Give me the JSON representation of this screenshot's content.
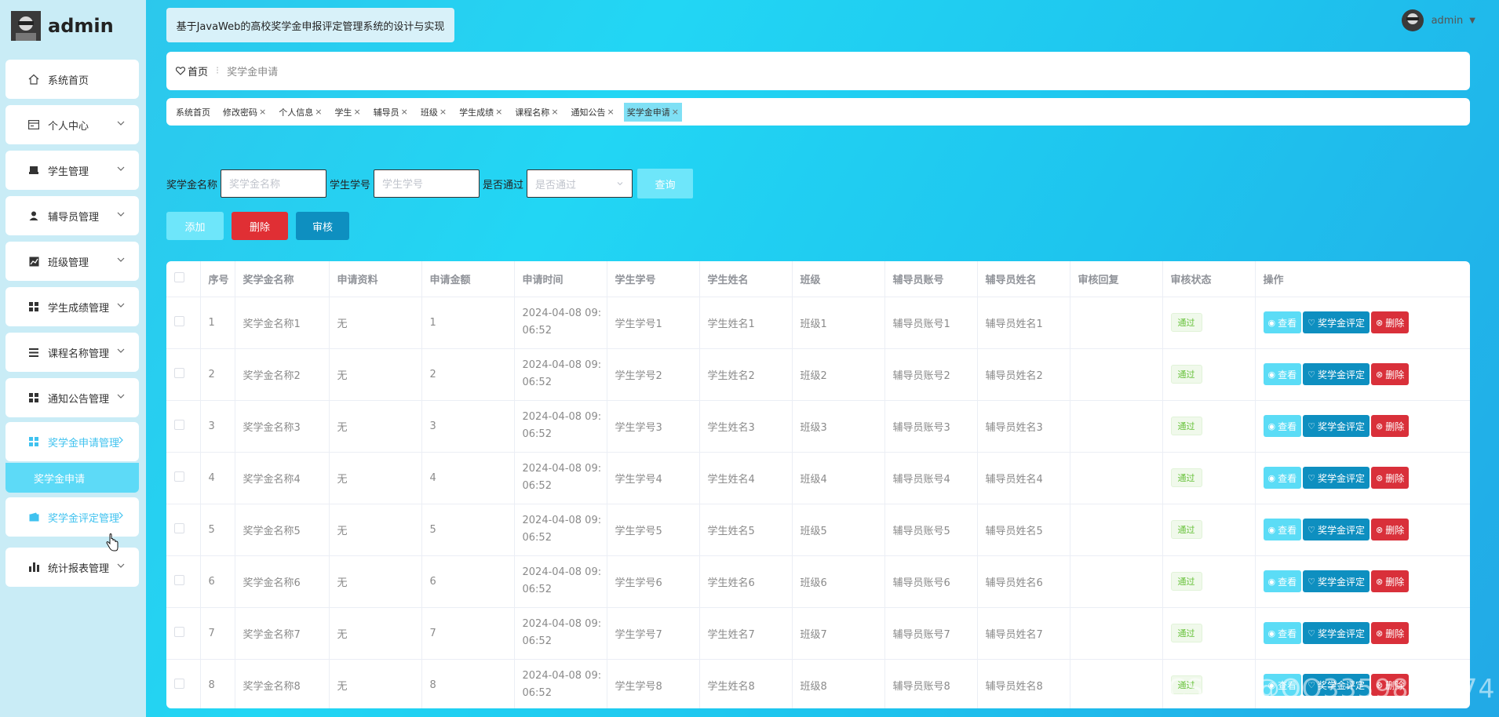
{
  "sidebar": {
    "brand": "admin",
    "items": [
      {
        "label": "系统首页",
        "icon": "home-icon"
      },
      {
        "label": "个人中心",
        "icon": "id-card-icon"
      },
      {
        "label": "学生管理",
        "icon": "student-icon"
      },
      {
        "label": "辅导员管理",
        "icon": "user-icon"
      },
      {
        "label": "班级管理",
        "icon": "chart-icon"
      },
      {
        "label": "学生成绩管理",
        "icon": "grid-icon"
      },
      {
        "label": "课程名称管理",
        "icon": "list-icon"
      },
      {
        "label": "通知公告管理",
        "icon": "grid-icon"
      },
      {
        "label": "奖学金申请管理",
        "icon": "grid-icon"
      },
      {
        "label": "奖学金评定管理",
        "icon": "wallet-icon"
      },
      {
        "label": "统计报表管理",
        "icon": "bar-chart-icon"
      }
    ],
    "sub_item": "奖学金申请"
  },
  "header": {
    "title": "基于JavaWeb的高校奖学金申报评定管理系统的设计与实现",
    "user": "admin"
  },
  "breadcrumb": {
    "home": "首页",
    "current": "奖学金申请"
  },
  "tags": [
    "系统首页",
    "修改密码",
    "个人信息",
    "学生",
    "辅导员",
    "班级",
    "学生成绩",
    "课程名称",
    "通知公告",
    "奖学金申请"
  ],
  "search": {
    "name_label": "奖学金名称",
    "name_placeholder": "奖学金名称",
    "no_label": "学生学号",
    "no_placeholder": "学生学号",
    "pass_label": "是否通过",
    "pass_placeholder": "是否通过",
    "query": "查询"
  },
  "actions": {
    "add": "添加",
    "delete": "删除",
    "audit": "审核"
  },
  "table": {
    "headers": [
      "序号",
      "奖学金名称",
      "申请资料",
      "申请金额",
      "申请时间",
      "学生学号",
      "学生姓名",
      "班级",
      "辅导员账号",
      "辅导员姓名",
      "审核回复",
      "审核状态",
      "操作"
    ],
    "rows": [
      {
        "idx": "1",
        "name": "奖学金名称1",
        "material": "无",
        "amount": "1",
        "time1": "2024-04-08 09:",
        "time2": "06:52",
        "sno": "学生学号1",
        "sname": "学生姓名1",
        "cls": "班级1",
        "tacc": "辅导员账号1",
        "tname": "辅导员姓名1",
        "reply": "",
        "status": "通过"
      },
      {
        "idx": "2",
        "name": "奖学金名称2",
        "material": "无",
        "amount": "2",
        "time1": "2024-04-08 09:",
        "time2": "06:52",
        "sno": "学生学号2",
        "sname": "学生姓名2",
        "cls": "班级2",
        "tacc": "辅导员账号2",
        "tname": "辅导员姓名2",
        "reply": "",
        "status": "通过"
      },
      {
        "idx": "3",
        "name": "奖学金名称3",
        "material": "无",
        "amount": "3",
        "time1": "2024-04-08 09:",
        "time2": "06:52",
        "sno": "学生学号3",
        "sname": "学生姓名3",
        "cls": "班级3",
        "tacc": "辅导员账号3",
        "tname": "辅导员姓名3",
        "reply": "",
        "status": "通过"
      },
      {
        "idx": "4",
        "name": "奖学金名称4",
        "material": "无",
        "amount": "4",
        "time1": "2024-04-08 09:",
        "time2": "06:52",
        "sno": "学生学号4",
        "sname": "学生姓名4",
        "cls": "班级4",
        "tacc": "辅导员账号4",
        "tname": "辅导员姓名4",
        "reply": "",
        "status": "通过"
      },
      {
        "idx": "5",
        "name": "奖学金名称5",
        "material": "无",
        "amount": "5",
        "time1": "2024-04-08 09:",
        "time2": "06:52",
        "sno": "学生学号5",
        "sname": "学生姓名5",
        "cls": "班级5",
        "tacc": "辅导员账号5",
        "tname": "辅导员姓名5",
        "reply": "",
        "status": "通过"
      },
      {
        "idx": "6",
        "name": "奖学金名称6",
        "material": "无",
        "amount": "6",
        "time1": "2024-04-08 09:",
        "time2": "06:52",
        "sno": "学生学号6",
        "sname": "学生姓名6",
        "cls": "班级6",
        "tacc": "辅导员账号6",
        "tname": "辅导员姓名6",
        "reply": "",
        "status": "通过"
      },
      {
        "idx": "7",
        "name": "奖学金名称7",
        "material": "无",
        "amount": "7",
        "time1": "2024-04-08 09:",
        "time2": "06:52",
        "sno": "学生学号7",
        "sname": "学生姓名7",
        "cls": "班级7",
        "tacc": "辅导员账号7",
        "tname": "辅导员姓名7",
        "reply": "",
        "status": "通过"
      },
      {
        "idx": "8",
        "name": "奖学金名称8",
        "material": "无",
        "amount": "8",
        "time1": "2024-04-08 09:",
        "time2": "06:52",
        "sno": "学生学号8",
        "sname": "学生姓名8",
        "cls": "班级8",
        "tacc": "辅导员账号8",
        "tname": "辅导员姓名8",
        "reply": "",
        "status": "通过"
      }
    ],
    "ops": {
      "view": "查看",
      "evaluate": "奖学金评定",
      "delete": "删除"
    }
  },
  "watermark": "CSDN @QQ3359892174",
  "colors": {
    "accent": "#22d6f4",
    "danger": "#e02f34",
    "primary": "#0e8fc0",
    "sidebar": "#c9ecf6"
  }
}
